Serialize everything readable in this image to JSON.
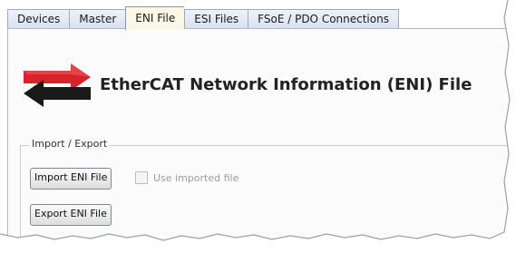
{
  "tabs": [
    {
      "label": "Devices"
    },
    {
      "label": "Master"
    },
    {
      "label": "ENI File",
      "active": true
    },
    {
      "label": "ESI Files"
    },
    {
      "label": "FSoE / PDO Connections"
    }
  ],
  "header": {
    "title": "EtherCAT Network Information (ENI) File",
    "logo_icon": "exchange-arrows-icon",
    "logo_colors": {
      "red": "#d8232a",
      "black": "#1a1a1a"
    }
  },
  "import_export": {
    "group_label": "Import / Export",
    "import_button": "Import ENI File",
    "use_imported_label": "Use imported file",
    "use_imported_checked": false,
    "use_imported_enabled": false,
    "export_button": "Export ENI File"
  }
}
